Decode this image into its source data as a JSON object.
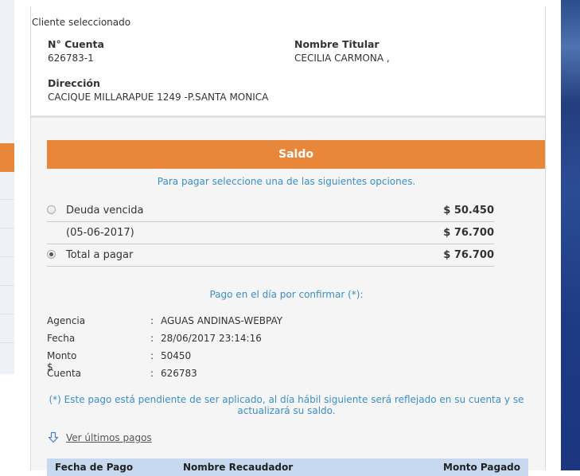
{
  "client": {
    "title": "Cliente seleccionado",
    "account_label": "N° Cuenta",
    "account_value": "626783-1",
    "holder_label": "Nombre Titular",
    "holder_value": "CECILIA CARMONA ,",
    "address_label": "Dirección",
    "address_value": "CACIQUE MILLARAPUE 1249 -P.SANTA MONICA"
  },
  "saldo": {
    "header": "Saldo",
    "instruction": "Para pagar seleccione una de las siguientes opciones.",
    "options": [
      {
        "label": "Deuda vencida",
        "amount": "$ 50.450",
        "radio": true,
        "checked": false
      },
      {
        "label": "(05-06-2017)",
        "amount": "$ 76.700",
        "radio": false,
        "checked": false
      },
      {
        "label": "Total a pagar",
        "amount": "$ 76.700",
        "radio": true,
        "checked": true
      }
    ]
  },
  "pending": {
    "title": "Pago en el día por confirmar (*):",
    "rows": [
      {
        "key": "Agencia",
        "sep": ":",
        "value": "AGUAS ANDINAS-WEBPAY"
      },
      {
        "key": "Fecha",
        "sep": ":",
        "value": "28/06/2017 23:14:16"
      },
      {
        "key": "Monto $",
        "sep": ":",
        "value": "50450"
      },
      {
        "key": "Cuenta",
        "sep": ":",
        "value": "626783"
      }
    ],
    "note": "(*) Este pago está pendiente de ser aplicado, al día hábil siguiente será reflejado en su cuenta y se actualizará su saldo."
  },
  "history": {
    "link_label": "Ver últimos pagos",
    "icon": "download-arrow-icon",
    "columns": [
      "Fecha de Pago",
      "Nombre Recaudador",
      "Monto Pagado"
    ]
  },
  "colors": {
    "accent": "#e8873a",
    "link_blue": "#3a8fc7",
    "table_header": "#c7d9ee"
  }
}
